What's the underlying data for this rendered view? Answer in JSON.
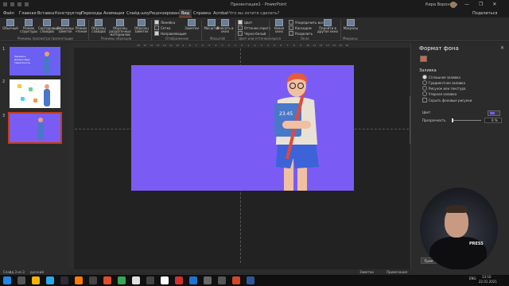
{
  "titlebar": {
    "doc_title": "Презентация1 - PowerPoint",
    "user": "Кира Воронина",
    "window_controls": [
      "—",
      "❐",
      "✕"
    ]
  },
  "tabs": {
    "items": [
      "Файл",
      "Главная",
      "Вставка",
      "Конструктор",
      "Переходы",
      "Анимация",
      "Слайд-шоу",
      "Рецензирование",
      "Вид",
      "Справка",
      "Acrobat"
    ],
    "active": "Вид",
    "search": "Что вы хотите сделать?",
    "share": "Поделиться"
  },
  "ribbon": {
    "buttons": [
      "Обычный",
      "Режим структуры",
      "Сортировщик слайдов",
      "Страницы заметок",
      "Режим чтения",
      "Образец слайдов",
      "Образец раздаточных материалов",
      "Образец заметок",
      "Заметки",
      "Масштаб",
      "Вписать в окно",
      "Новое окно",
      "Перейти в другое окно",
      "Макросы"
    ],
    "checks": [
      {
        "label": "Линейка",
        "on": true
      },
      {
        "label": "Сетка",
        "on": false
      },
      {
        "label": "Направляющие",
        "on": true
      },
      {
        "label": "Цвет",
        "on": true
      },
      {
        "label": "Оттенки серого",
        "on": false
      },
      {
        "label": "Черно-белый",
        "on": false
      },
      {
        "label": "Упорядочить все",
        "on": false
      },
      {
        "label": "Каскадом",
        "on": false
      },
      {
        "label": "Разделить",
        "on": false
      }
    ],
    "groups": [
      "Режимы просмотра презентации",
      "Режимы образцов",
      "Отображение",
      "Масштаб",
      "Цвет или оттенки серого",
      "Окно",
      "Макросы"
    ]
  },
  "slides_panel": {
    "numbers": [
      "1",
      "2",
      "3"
    ],
    "slide1_title": "Заказать финансовую грамотность",
    "selected": 3
  },
  "ruler": {
    "ticks": [
      "16",
      "15",
      "14",
      "13",
      "12",
      "11",
      "10",
      "9",
      "8",
      "7",
      "6",
      "5",
      "4",
      "3",
      "2",
      "1",
      "0",
      "1",
      "2",
      "3",
      "4",
      "5",
      "6",
      "7",
      "8",
      "9",
      "10",
      "11",
      "12",
      "13",
      "14",
      "15",
      "16"
    ]
  },
  "slide": {
    "background": "#7a5cf5",
    "badge": "23.45"
  },
  "format_pane": {
    "title": "Формат фона",
    "close": "✕",
    "section": "Заливка",
    "options": [
      {
        "label": "Сплошная заливка",
        "on": true
      },
      {
        "label": "Градиентная заливка",
        "on": false
      },
      {
        "label": "Рисунок или текстура",
        "on": false
      },
      {
        "label": "Узорная заливка",
        "on": false
      }
    ],
    "hide_bg": "Скрыть фоновые рисунки",
    "color_label": "Цвет",
    "transparency_label": "Прозрачность",
    "transparency_value": "0 %",
    "apply_button": "Прим"
  },
  "webcam": {
    "overlay": "PRESS"
  },
  "statusbar": {
    "slide_info": "Слайд 3 из 3",
    "language": "русский",
    "notes": "Заметки",
    "comments": "Примечания"
  },
  "taskbar": {
    "time": "13:10",
    "date": "22.01.2021",
    "lang": "ENG"
  },
  "colors": {
    "accent": "#c43e1c",
    "slide_bg": "#7a5cf5"
  }
}
